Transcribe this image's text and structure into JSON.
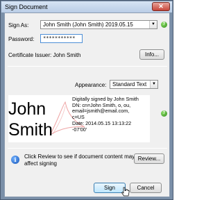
{
  "window": {
    "title": "Sign Document",
    "close_glyph": "✕"
  },
  "sign_as": {
    "label": "Sign As:",
    "value": "John Smith (John Smith) 2019.05.15"
  },
  "password": {
    "label": "Password:",
    "value": "***********"
  },
  "certificate": {
    "label": "Certificate Issuer: John Smith",
    "info_button": "Info..."
  },
  "appearance": {
    "label": "Appearance:",
    "value": "Standard Text"
  },
  "preview": {
    "first_name": "John",
    "last_name": "Smith",
    "detail_lines": [
      "Digitally signed by John Smith",
      "DN: cn=John Smith, o, ou,",
      "email=jsmith@email.com,",
      "c=US",
      "Date: 2014.05.15 13:13:22",
      "-07'00'"
    ]
  },
  "review": {
    "text": "Click Review to see if document content may affect signing",
    "button": "Review..."
  },
  "actions": {
    "sign": "Sign",
    "cancel": "Cancel"
  },
  "icons": {
    "help": "help-icon",
    "info": "info-icon",
    "dropdown": "chevron-down-icon"
  },
  "colors": {
    "help_green": "#2f8a18",
    "info_blue": "#1756b8",
    "title_bar": "#c6d7ed",
    "watermark_red": "#e05a5a"
  }
}
